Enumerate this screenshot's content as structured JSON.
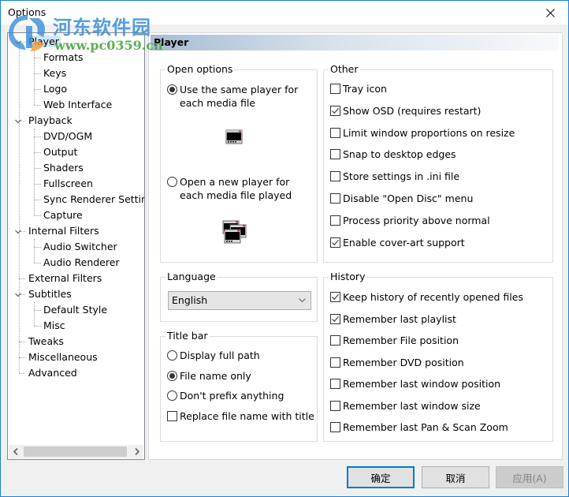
{
  "window": {
    "title": "Options",
    "close_icon": "close-icon"
  },
  "watermark": {
    "text_cn": "河东软件园",
    "url": "www.pc0359.cn"
  },
  "tree": {
    "items": [
      {
        "label": "Player",
        "level": 0,
        "expanded": true,
        "selected": true
      },
      {
        "label": "Formats",
        "level": 1
      },
      {
        "label": "Keys",
        "level": 1
      },
      {
        "label": "Logo",
        "level": 1
      },
      {
        "label": "Web Interface",
        "level": 1
      },
      {
        "label": "Playback",
        "level": 0,
        "expanded": true
      },
      {
        "label": "DVD/OGM",
        "level": 1
      },
      {
        "label": "Output",
        "level": 1
      },
      {
        "label": "Shaders",
        "level": 1
      },
      {
        "label": "Fullscreen",
        "level": 1
      },
      {
        "label": "Sync Renderer Setting",
        "level": 1
      },
      {
        "label": "Capture",
        "level": 1
      },
      {
        "label": "Internal Filters",
        "level": 0,
        "expanded": true
      },
      {
        "label": "Audio Switcher",
        "level": 1
      },
      {
        "label": "Audio Renderer",
        "level": 1
      },
      {
        "label": "External Filters",
        "level": 0
      },
      {
        "label": "Subtitles",
        "level": 0,
        "expanded": true
      },
      {
        "label": "Default Style",
        "level": 1
      },
      {
        "label": "Misc",
        "level": 1
      },
      {
        "label": "Tweaks",
        "level": 0
      },
      {
        "label": "Miscellaneous",
        "level": 0
      },
      {
        "label": "Advanced",
        "level": 0
      }
    ],
    "scroll_left_icon": "chevron-left-icon",
    "scroll_right_icon": "chevron-right-icon"
  },
  "panel": {
    "header": "Player",
    "open_options": {
      "title": "Open options",
      "options": [
        {
          "label": "Use the same player for each media file",
          "checked": true,
          "icon": "single-player-window-icon"
        },
        {
          "label": "Open a new player for each media file played",
          "checked": false,
          "icon": "multiple-player-windows-icon"
        }
      ]
    },
    "other": {
      "title": "Other",
      "options": [
        {
          "label": "Tray icon",
          "checked": false
        },
        {
          "label": "Show OSD (requires restart)",
          "checked": true
        },
        {
          "label": "Limit window proportions on resize",
          "checked": false
        },
        {
          "label": "Snap to desktop edges",
          "checked": false
        },
        {
          "label": "Store settings in .ini file",
          "checked": false
        },
        {
          "label": "Disable \"Open Disc\" menu",
          "checked": false
        },
        {
          "label": "Process priority above normal",
          "checked": false
        },
        {
          "label": "Enable cover-art support",
          "checked": true
        }
      ]
    },
    "language": {
      "title": "Language",
      "selected": "English"
    },
    "title_bar": {
      "title": "Title bar",
      "radios": [
        {
          "label": "Display full path",
          "checked": false
        },
        {
          "label": "File name only",
          "checked": true
        },
        {
          "label": "Don't prefix anything",
          "checked": false
        }
      ],
      "checkbox": {
        "label": "Replace file name with title",
        "checked": false
      }
    },
    "history": {
      "title": "History",
      "options": [
        {
          "label": "Keep history of recently opened files",
          "checked": true
        },
        {
          "label": "Remember last playlist",
          "checked": true
        },
        {
          "label": "Remember File position",
          "checked": false
        },
        {
          "label": "Remember DVD position",
          "checked": false
        },
        {
          "label": "Remember last window position",
          "checked": false
        },
        {
          "label": "Remember last window size",
          "checked": false
        },
        {
          "label": "Remember last Pan & Scan Zoom",
          "checked": false
        }
      ]
    }
  },
  "buttons": {
    "ok": "确定",
    "cancel": "取消",
    "apply": "应用(A)",
    "apply_enabled": false
  },
  "colors": {
    "accent": "#0078d7",
    "window_border": "#1883d7",
    "selection": "#cce8ff"
  }
}
